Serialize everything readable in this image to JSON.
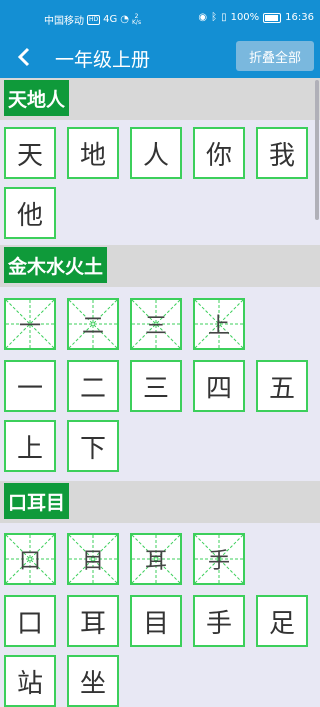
{
  "status": {
    "carrier": "中国移动",
    "hd": "HD",
    "signal": "4G",
    "speed_value": "2",
    "speed_unit": "K/s",
    "battery": "100%",
    "time": "16:36"
  },
  "app_bar": {
    "back": "‹",
    "title": "一年级上册",
    "fold_all": "折叠全部"
  },
  "sections": [
    {
      "label": "天地人",
      "tiles": [
        "天",
        "地",
        "人",
        "你",
        "我",
        "他"
      ]
    },
    {
      "label": "金木水火土",
      "grid_tiles": [
        "一",
        "二",
        "三",
        "上"
      ],
      "tiles": [
        "一",
        "二",
        "三",
        "四",
        "五",
        "上",
        "下"
      ]
    },
    {
      "label": "口耳目",
      "grid_tiles": [
        "口",
        "目",
        "耳",
        "手"
      ],
      "tiles": [
        "口",
        "耳",
        "目",
        "手",
        "足",
        "站",
        "坐"
      ]
    }
  ]
}
